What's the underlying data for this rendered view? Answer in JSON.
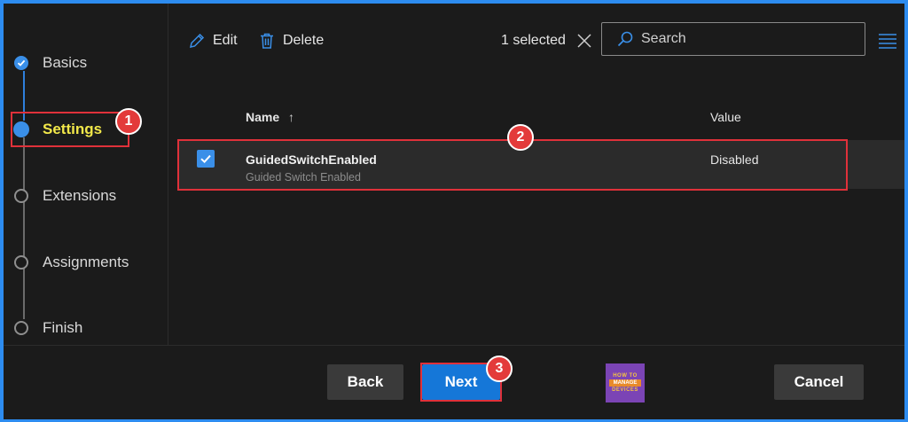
{
  "steps": [
    {
      "label": "Basics",
      "state": "done"
    },
    {
      "label": "Settings",
      "state": "active"
    },
    {
      "label": "Extensions",
      "state": "pending"
    },
    {
      "label": "Assignments",
      "state": "pending"
    },
    {
      "label": "Finish",
      "state": "pending"
    }
  ],
  "toolbar": {
    "edit_label": "Edit",
    "delete_label": "Delete",
    "selected_text": "1 selected",
    "search_placeholder": "Search"
  },
  "table": {
    "columns": [
      "Name",
      "Value"
    ],
    "sort_indicator": "↑",
    "rows": [
      {
        "name": "GuidedSwitchEnabled",
        "subtitle": "Guided Switch Enabled",
        "value": "Disabled",
        "checked": true
      }
    ]
  },
  "footer": {
    "back_label": "Back",
    "next_label": "Next",
    "cancel_label": "Cancel"
  },
  "callouts": [
    "1",
    "2",
    "3"
  ],
  "logo": {
    "line1": "HOW TO",
    "line2": "MANAGE",
    "line3": "DEVICES"
  },
  "colors": {
    "accent": "#3a8fe8",
    "callout": "#e0313a",
    "active_label": "#f2e84a",
    "frame": "#2d8cf0"
  }
}
